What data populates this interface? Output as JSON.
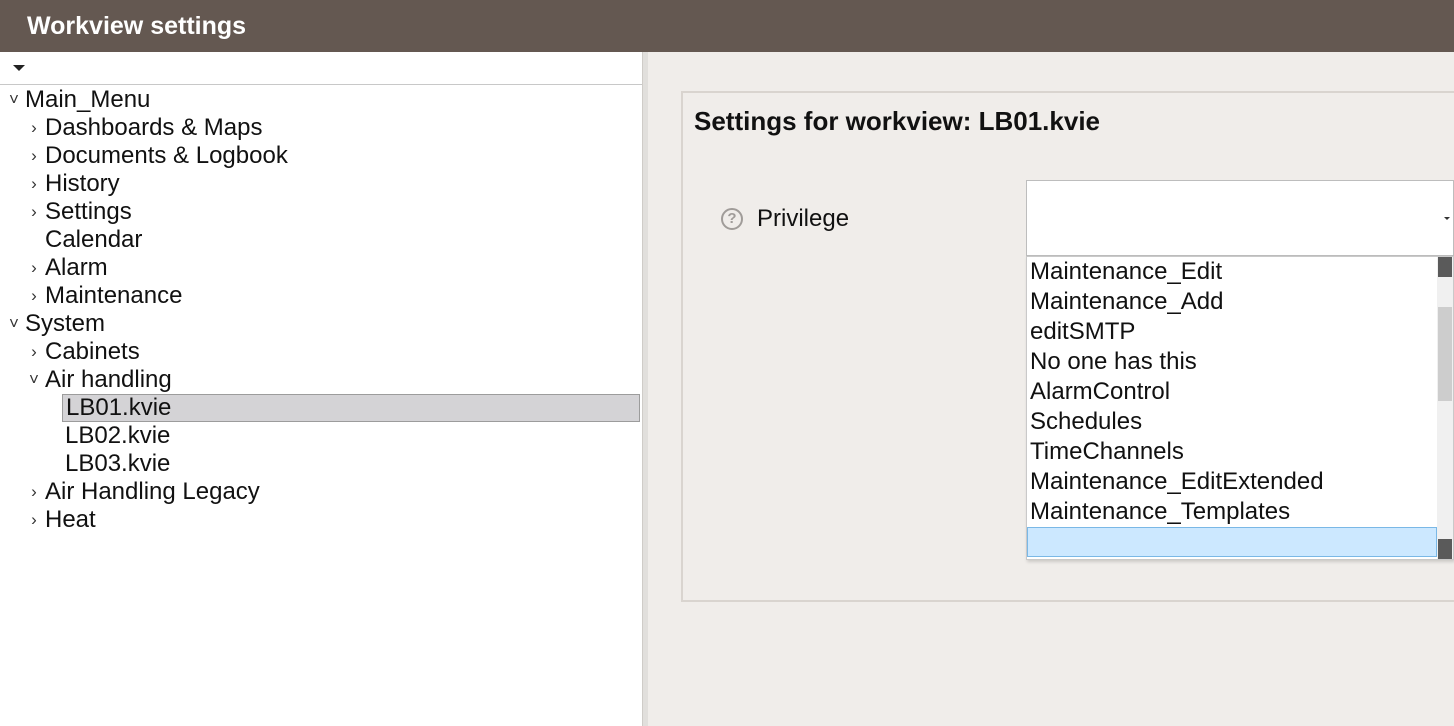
{
  "window": {
    "title": "Workview settings"
  },
  "tree": {
    "nodes": [
      {
        "label": "Main_Menu",
        "chevron": "˅"
      },
      {
        "label": "Dashboards & Maps",
        "chevron": "›"
      },
      {
        "label": "Documents & Logbook",
        "chevron": "›"
      },
      {
        "label": "History",
        "chevron": "›"
      },
      {
        "label": "Settings",
        "chevron": "›"
      },
      {
        "label": "Calendar",
        "chevron": ""
      },
      {
        "label": "Alarm",
        "chevron": "›"
      },
      {
        "label": "Maintenance",
        "chevron": "›"
      },
      {
        "label": "System",
        "chevron": "˅"
      },
      {
        "label": "Cabinets",
        "chevron": "›"
      },
      {
        "label": "Air handling",
        "chevron": "˅"
      },
      {
        "label": "LB01.kvie",
        "chevron": ""
      },
      {
        "label": "LB02.kvie",
        "chevron": ""
      },
      {
        "label": "LB03.kvie",
        "chevron": ""
      },
      {
        "label": "Air Handling Legacy",
        "chevron": "›"
      },
      {
        "label": "Heat",
        "chevron": "›"
      }
    ],
    "selected": "LB01.kvie"
  },
  "settings": {
    "title": "Settings for workview: LB01.kvie",
    "help_icon": "?",
    "privilege_label": "Privilege",
    "privilege_value": "",
    "options": [
      "Maintenance_Edit",
      "Maintenance_Add",
      "editSMTP",
      "No one has this",
      "AlarmControl",
      "Schedules",
      "TimeChannels",
      "Maintenance_EditExtended",
      "Maintenance_Templates",
      ""
    ],
    "highlighted_index": 9
  },
  "colors": {
    "titlebar": "#645851",
    "right_background": "#f0edea",
    "selected_row": "#d4d3d6",
    "highlight_option": "#cce8ff"
  }
}
